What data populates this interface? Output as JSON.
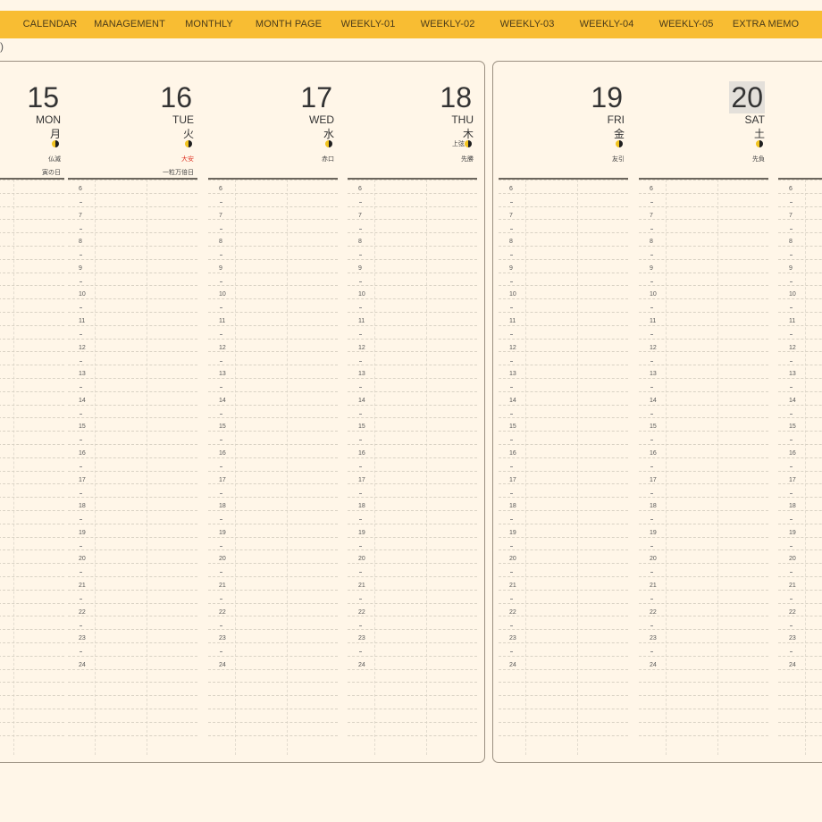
{
  "nav": {
    "items": [
      "CALENDAR",
      "MANAGEMENT",
      "MONTHLY",
      "MONTH PAGE",
      "WEEKLY-01",
      "WEEKLY-02",
      "WEEKLY-03",
      "WEEKLY-04",
      "WEEKLY-05",
      "EXTRA MEMO"
    ]
  },
  "header_fragment": ")",
  "left_page": {
    "days": [
      {
        "num": "15",
        "dow": "MON",
        "kanji": "月",
        "rokuyo": "仏滅",
        "rokuyo_red": false,
        "extra": "寅の日",
        "highlight": false
      },
      {
        "num": "16",
        "dow": "TUE",
        "kanji": "火",
        "rokuyo": "大安",
        "rokuyo_red": true,
        "extra": "一粒万倍日",
        "highlight": false
      },
      {
        "num": "17",
        "dow": "WED",
        "kanji": "水",
        "rokuyo": "赤口",
        "rokuyo_red": false,
        "extra": "",
        "highlight": false
      },
      {
        "num": "18",
        "dow": "THU",
        "kanji": "木",
        "rokuyo": "先勝",
        "rokuyo_red": false,
        "extra": "",
        "moon_note": "上弦",
        "highlight": false
      }
    ]
  },
  "right_page": {
    "days": [
      {
        "num": "19",
        "dow": "FRI",
        "kanji": "金",
        "rokuyo": "友引",
        "rokuyo_red": false,
        "extra": "",
        "highlight": false
      },
      {
        "num": "20",
        "dow": "SAT",
        "kanji": "土",
        "rokuyo": "先負",
        "rokuyo_red": false,
        "extra": "",
        "highlight": true
      },
      {
        "num": "",
        "dow": "",
        "kanji": "",
        "rokuyo": "",
        "rokuyo_red": false,
        "extra": "",
        "highlight": false
      }
    ]
  },
  "hours": [
    "6",
    "7",
    "8",
    "9",
    "10",
    "11",
    "12",
    "13",
    "14",
    "15",
    "16",
    "17",
    "18",
    "19",
    "20",
    "21",
    "22",
    "23",
    "24"
  ],
  "colors": {
    "accent": "#f8bd33",
    "background": "#fff6e8",
    "text": "#3c3a36",
    "rokuyo_red": "#e0392a"
  }
}
